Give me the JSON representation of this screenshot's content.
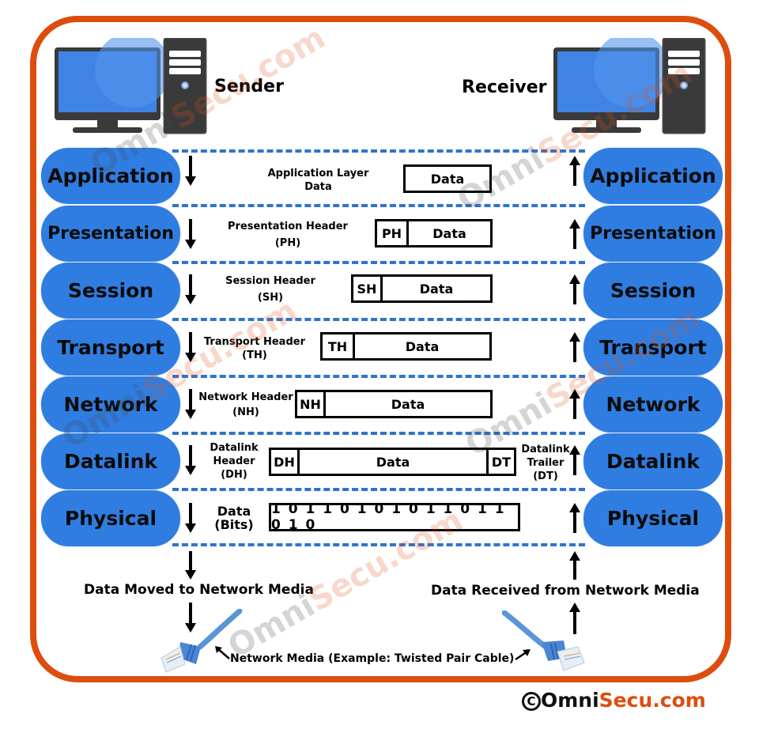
{
  "sender": {
    "label": "Sender",
    "icon": "desktop-computer-icon"
  },
  "receiver": {
    "label": "Receiver",
    "icon": "desktop-computer-icon"
  },
  "layers": [
    {
      "name": "Application",
      "description": [
        "Application Layer",
        "Data"
      ],
      "pdu": {
        "header": "",
        "body": "Data",
        "trailer": ""
      }
    },
    {
      "name": "Presentation",
      "description": [
        "Presentation Header",
        "(PH)"
      ],
      "pdu": {
        "header": "PH",
        "body": "Data",
        "trailer": ""
      }
    },
    {
      "name": "Session",
      "description": [
        "Session Header",
        "(SH)"
      ],
      "pdu": {
        "header": "SH",
        "body": "Data",
        "trailer": ""
      }
    },
    {
      "name": "Transport",
      "description": [
        "Transport Header",
        "(TH)"
      ],
      "pdu": {
        "header": "TH",
        "body": "Data",
        "trailer": ""
      }
    },
    {
      "name": "Network",
      "description": [
        "Network Header",
        "(NH)"
      ],
      "pdu": {
        "header": "NH",
        "body": "Data",
        "trailer": ""
      }
    },
    {
      "name": "Datalink",
      "description": [
        "Datalink",
        "Header",
        "(DH)"
      ],
      "trailer_description": [
        "Datalink",
        "Trailer",
        "(DT)"
      ],
      "pdu": {
        "header": "DH",
        "body": "Data",
        "trailer": "DT"
      }
    },
    {
      "name": "Physical",
      "description": [
        "Data",
        "(Bits)"
      ],
      "pdu": {
        "bits": "1 0 1 1 0 1 0 1 0 1 1 0 1 1 0 1 0"
      }
    }
  ],
  "bottom": {
    "sender_label": "Data Moved to Network Media",
    "receiver_label": "Data Received from Network Media",
    "media_label": "Network Media (Example: Twisted Pair Cable)",
    "media_icon": "ethernet-cable-icon"
  },
  "watermark": {
    "part1": "Omni",
    "part2": "Secu.com"
  },
  "copyright": {
    "symbol": "C",
    "part1": "Omni",
    "part2": "Secu.com"
  },
  "colors": {
    "frame": "#dd4d0e",
    "layer_pill": "#2f7de1",
    "dash": "#2f74cc",
    "brand_orange": "#dd4d0e"
  }
}
